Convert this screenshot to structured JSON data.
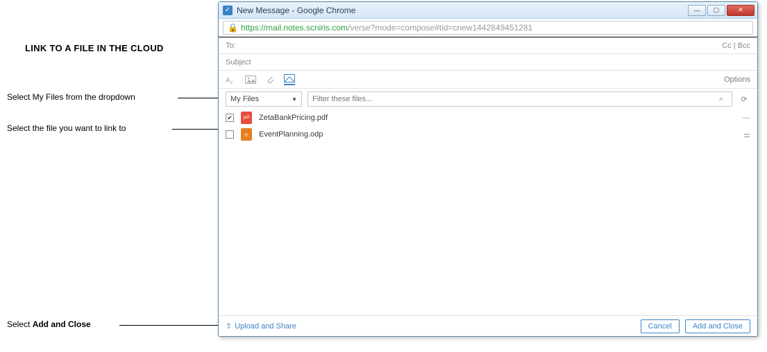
{
  "annotations": {
    "heading": "LINK TO A FILE IN THE CLOUD",
    "step1": "Select My Files from the dropdown",
    "step2": "Select the file you want to link to",
    "step3_prefix": "Select ",
    "step3_bold": "Add and Close"
  },
  "window": {
    "title": "New Message - Google Chrome",
    "url_scheme": "https://",
    "url_host": "mail.notes.scniris.com",
    "url_path": "/verse?mode=compose#tid=cnew1442849451281"
  },
  "compose": {
    "to_label": "To:",
    "cc_label": "Cc",
    "bcc_label": "Bcc",
    "subject_placeholder": "Subject",
    "options_label": "Options"
  },
  "toolbar_icons": {
    "format": "A",
    "image": "▭",
    "attach": "⧉",
    "cloud": "✉"
  },
  "dropdown": {
    "selected": "My Files"
  },
  "filter": {
    "placeholder": "Filter these files...",
    "search_icon": "⌕",
    "refresh_icon": "⟳"
  },
  "files": [
    {
      "name": "ZetaBankPricing.pdf",
      "type": "pdf",
      "checked": true,
      "action_glyph": "—"
    },
    {
      "name": "EventPlanning.odp",
      "type": "odp",
      "checked": false,
      "action_glyph": "⚌"
    }
  ],
  "footer": {
    "upload_label": "Upload and Share",
    "cancel": "Cancel",
    "add_close": "Add and Close",
    "upload_icon": "⇪"
  }
}
